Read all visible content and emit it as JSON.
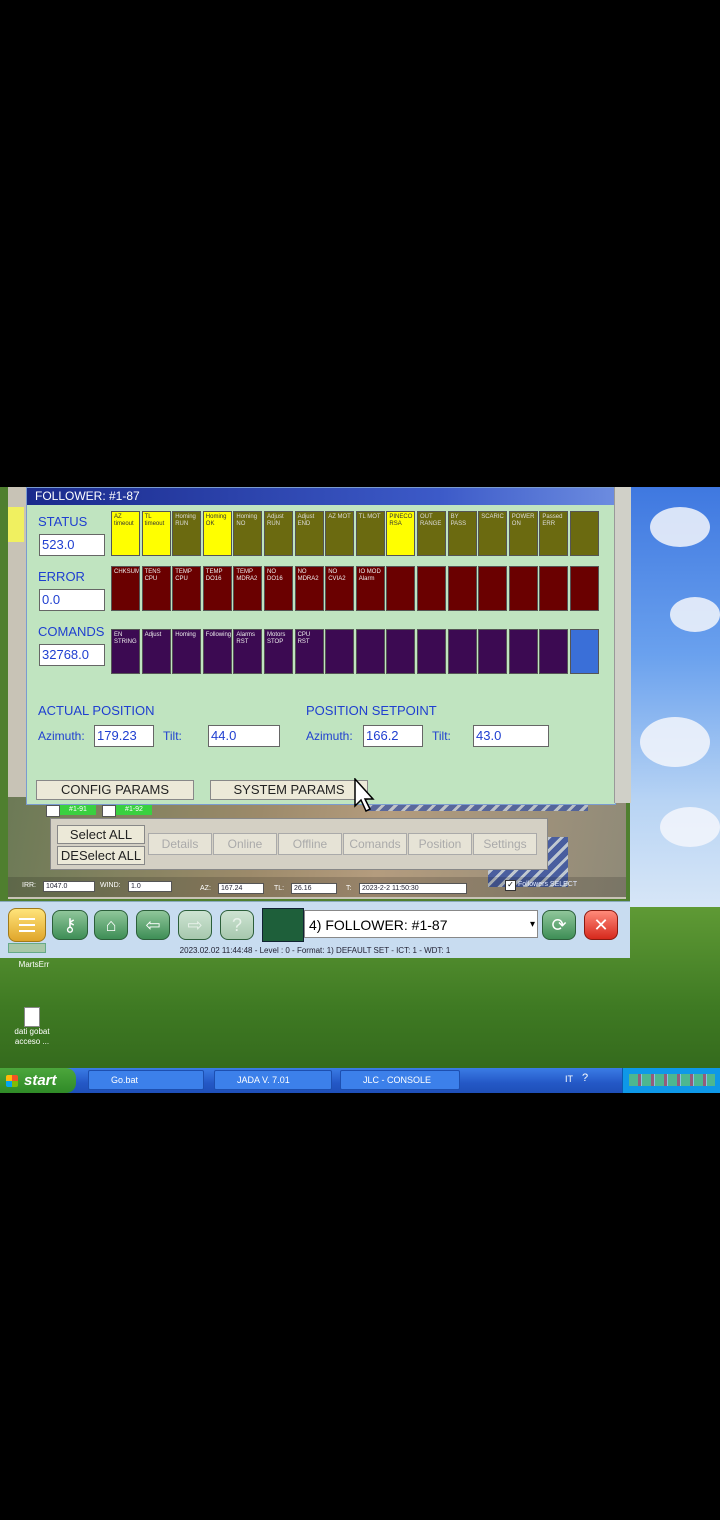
{
  "window": {
    "title": "FOLLOWER: #1-87"
  },
  "status": {
    "label": "STATUS",
    "value": "523.0",
    "cells": [
      {
        "text": "AZ timeout",
        "color": "yellow"
      },
      {
        "text": "TL timeout",
        "color": "yellow"
      },
      {
        "text": "Homing RUN",
        "color": "olive"
      },
      {
        "text": "Homing OK",
        "color": "yellow"
      },
      {
        "text": "Homing NO",
        "color": "olive"
      },
      {
        "text": "Adjust RUN",
        "color": "olive"
      },
      {
        "text": "Adjust END",
        "color": "olive"
      },
      {
        "text": "AZ MOT",
        "color": "olive"
      },
      {
        "text": "TL MOT",
        "color": "olive"
      },
      {
        "text": "PINECO RSA",
        "color": "yellow"
      },
      {
        "text": "OUT RANGE",
        "color": "olive"
      },
      {
        "text": "BY PASS",
        "color": "olive"
      },
      {
        "text": "SCARIC",
        "color": "olive"
      },
      {
        "text": "POWER ON",
        "color": "olive"
      },
      {
        "text": "Passed ERR",
        "color": "olive"
      },
      {
        "text": "",
        "color": "olive"
      }
    ]
  },
  "error": {
    "label": "ERROR",
    "value": "0.0",
    "cells": [
      "CHKSUM",
      "TENS CPU",
      "TEMP CPU",
      "TEMP DO16",
      "TEMP MDRA2",
      "NO DO16",
      "NO MDRA2",
      "NO CVIA2",
      "IO MOD Alarm",
      "",
      "",
      "",
      "",
      "",
      "",
      ""
    ]
  },
  "comands": {
    "label": "COMANDS",
    "value": "32768.0",
    "cells": [
      "EN STRING",
      "Adjust",
      "Homing",
      "Following",
      "Alarms RST",
      "Motors STOP",
      "CPU RST",
      "",
      "",
      "",
      "",
      "",
      "",
      "",
      "",
      ""
    ]
  },
  "actual_position": {
    "label": "ACTUAL POSITION",
    "azimuth_label": "Azimuth:",
    "azimuth": "179.23",
    "tilt_label": "Tilt:",
    "tilt": "44.0"
  },
  "position_setpoint": {
    "label": "POSITION SETPOINT",
    "azimuth_label": "Azimuth:",
    "azimuth": "166.2",
    "tilt_label": "Tilt:",
    "tilt": "43.0"
  },
  "buttons": {
    "config": "CONFIG PARAMS",
    "system": "SYSTEM PARAMS",
    "select_all": "Select ALL",
    "deselect_all": "DESelect ALL"
  },
  "followers_tabs": [
    "#1-91",
    "#1-92"
  ],
  "disabled_tabs": [
    "Details",
    "Online",
    "Offline",
    "Comands",
    "Position",
    "Settings"
  ],
  "bottom_readout": {
    "irr_label": "IRR:",
    "irr": "1047.0",
    "wind_label": "WIND:",
    "wind": "1.0",
    "az_label": "AZ:",
    "az": "167.24",
    "tl_label": "TL:",
    "tl": "26.16",
    "t_label": "T:",
    "t": "2023-2-2 11:50:30",
    "followers_select": "Followers SELECT"
  },
  "toolbar": {
    "selector": "4) FOLLOWER: #1-87",
    "status_line": "2023.02.02   11:44:48 - Level : 0 - Format: 1) DEFAULT SET - ICT: 1 - WDT: 1"
  },
  "desktop_icons": [
    {
      "label": "MartsErr"
    },
    {
      "label": "dati gobat acceso ..."
    }
  ],
  "taskbar": {
    "start": "start",
    "tasks": [
      "Go.bat",
      "JADA V. 7.01 FEB201...",
      "JLC - CONSOLE"
    ],
    "lang": "IT"
  },
  "colors": {
    "panel": "#c0e4c0",
    "status_yellow": "#ffff00",
    "status_olive": "#6b6a10",
    "error_red": "#6a0000",
    "command_purple": "#3c0a52",
    "accent_blue": "#1f3fd0"
  }
}
